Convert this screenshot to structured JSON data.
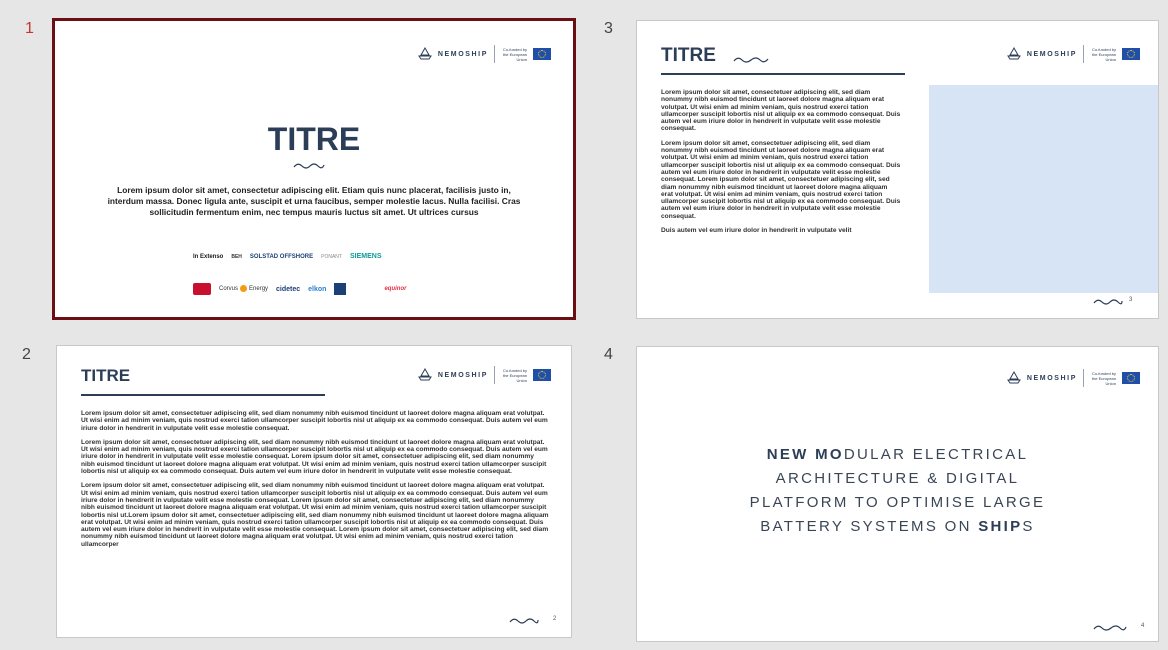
{
  "slides": {
    "s1": {
      "number": "1",
      "title": "TITRE",
      "body": "Lorem ipsum dolor sit amet, consectetur adipiscing elit. Etiam quis nunc placerat, facilisis justo in, interdum massa. Donec ligula ante, suscipit et urna faucibus, semper molestie lacus. Nulla facilisi. Cras sollicitudin fermentum enim, nec tempus mauris luctus sit amet. Ut ultrices cursus",
      "logos_row1": [
        "In Extenso",
        "BEH",
        "SOLSTAD OFFSHORE",
        "PONANT",
        "SIEMENS"
      ],
      "logos_row2": [
        "Corvus",
        "Energy",
        "cidetec",
        "elkon",
        "equinor"
      ]
    },
    "s2": {
      "number": "2",
      "title": "TITRE",
      "para1": "Lorem ipsum dolor sit amet, consectetuer adipiscing elit, sed diam nonummy nibh euismod tincidunt ut laoreet dolore magna aliquam erat volutpat. Ut wisi enim ad minim veniam, quis nostrud exerci tation ullamcorper suscipit lobortis nisl ut aliquip ex ea commodo consequat. Duis autem vel eum iriure dolor in hendrerit in vulputate velit esse molestie consequat.",
      "para2": "Lorem ipsum dolor sit amet, consectetuer adipiscing elit, sed diam nonummy nibh euismod tincidunt ut laoreet dolore magna aliquam erat volutpat. Ut wisi enim ad minim veniam, quis nostrud exerci tation ullamcorper suscipit lobortis nisl ut aliquip ex ea commodo consequat. Duis autem vel eum iriure dolor in hendrerit in vulputate velit esse molestie consequat. Lorem ipsum dolor sit amet, consectetuer adipiscing elit, sed diam nonummy nibh euismod tincidunt ut laoreet dolore magna aliquam erat volutpat. Ut wisi enim ad minim veniam, quis nostrud exerci tation ullamcorper suscipit lobortis nisl ut aliquip ex ea commodo consequat. Duis autem vel eum iriure dolor in hendrerit in vulputate velit esse molestie consequat.",
      "para3": "Lorem ipsum dolor sit amet, consectetuer adipiscing elit, sed diam nonummy nibh euismod tincidunt ut laoreet dolore magna aliquam erat volutpat. Ut wisi enim ad minim veniam, quis nostrud exerci tation ullamcorper suscipit lobortis nisl ut aliquip ex ea commodo consequat. Duis autem vel eum iriure dolor in hendrerit in vulputate velit esse molestie consequat. Lorem ipsum dolor sit amet, consectetuer adipiscing elit, sed diam nonummy nibh euismod tincidunt ut laoreet dolore magna aliquam erat volutpat. Ut wisi enim ad minim veniam, quis nostrud exerci tation ullamcorper suscipit lobortis nisl ut.Lorem ipsum dolor sit amet, consectetuer adipiscing elit, sed diam nonummy nibh euismod tincidunt ut laoreet dolore magna aliquam erat volutpat. Ut wisi enim ad minim veniam, quis nostrud exerci tation ullamcorper suscipit lobortis nisl ut aliquip ex ea commodo consequat. Duis autem vel eum iriure dolor in hendrerit in vulputate velit esse molestie consequat. Lorem ipsum dolor sit amet, consectetuer adipiscing elit, sed diam nonummy nibh euismod tincidunt ut laoreet dolore magna aliquam erat volutpat. Ut wisi enim ad minim veniam, quis nostrud exerci tation ullamcorper",
      "page": "2"
    },
    "s3": {
      "number": "3",
      "title": "TITRE",
      "para1": "Lorem ipsum dolor sit amet, consectetuer adipiscing elit, sed diam nonummy nibh euismod tincidunt ut laoreet dolore magna aliquam erat volutpat. Ut wisi enim ad minim veniam, quis nostrud exerci tation ullamcorper suscipit lobortis nisl ut aliquip ex ea commodo consequat. Duis autem vel eum iriure dolor in hendrerit in vulputate velit esse molestie consequat.",
      "para2": "Lorem ipsum dolor sit amet, consectetuer adipiscing elit, sed diam nonummy nibh euismod tincidunt ut laoreet dolore magna aliquam erat volutpat. Ut wisi enim ad minim veniam, quis nostrud exerci tation ullamcorper suscipit lobortis nisl ut aliquip ex ea commodo consequat. Duis autem vel eum iriure dolor in hendrerit in vulputate velit esse molestie consequat. Lorem ipsum dolor sit amet, consectetuer adipiscing elit, sed diam nonummy nibh euismod tincidunt ut laoreet dolore magna aliquam erat volutpat. Ut wisi enim ad minim veniam, quis nostrud exerci tation ullamcorper suscipit lobortis nisl ut aliquip ex ea commodo consequat. Duis autem vel eum iriure dolor in hendrerit in vulputate velit esse molestie consequat.",
      "para3": "Duis autem vel eum iriure dolor in hendrerit in vulputate velit",
      "page": "3"
    },
    "s4": {
      "number": "4",
      "headline": {
        "l1a": "NEW ",
        "l1b": "MO",
        "l1c": "DULAR ELECTRICAL",
        "l2": "ARCHITECTURE & DIGITAL",
        "l3": "PLATFORM TO OPTIMISE LARGE",
        "l4a": "BATTERY SYSTEMS ON ",
        "l4b": "SHIP",
        "l4c": "S"
      },
      "page": "4"
    }
  },
  "header": {
    "brand": "NEMOSHIP",
    "cofund": "Co-funded by the European Union"
  },
  "colors": {
    "navy": "#2c3e57",
    "selection_border": "#6b0f15",
    "blue_box": "#d6e4f5",
    "background": "#e6e6e6"
  }
}
